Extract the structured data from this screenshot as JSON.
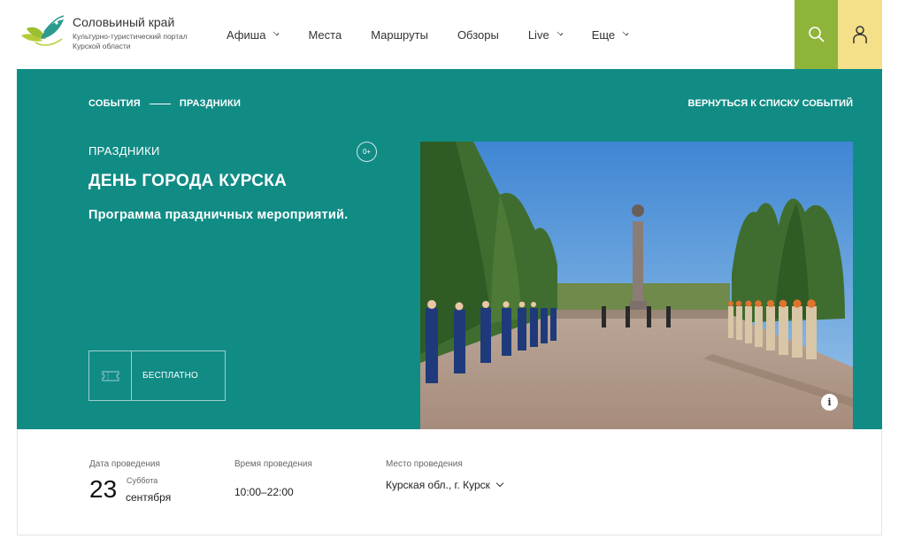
{
  "header": {
    "logo_title": "Соловьиный край",
    "logo_subtitle": "Культурно-туристический портал Курской области",
    "nav": [
      {
        "label": "Афиша",
        "has_dropdown": true
      },
      {
        "label": "Места",
        "has_dropdown": false
      },
      {
        "label": "Маршруты",
        "has_dropdown": false
      },
      {
        "label": "Обзоры",
        "has_dropdown": false
      },
      {
        "label": "Live",
        "has_dropdown": true
      },
      {
        "label": "Еще",
        "has_dropdown": true
      }
    ],
    "search_icon": "search-icon",
    "user_icon": "user-icon",
    "colors": {
      "search_bg": "#8fb43a",
      "user_bg": "#f4e089"
    }
  },
  "hero": {
    "breadcrumb": [
      "СОБЫТИЯ",
      "ПРАЗДНИКИ"
    ],
    "back_link": "ВЕРНУТЬСЯ К СПИСКУ СОБЫТИЙ",
    "category": "ПРАЗДНИКИ",
    "age_rating": "0+",
    "title": "ДЕНЬ ГОРОДА КУРСКА",
    "subtitle": "Программа праздничных мероприятий.",
    "ticket_label": "БЕСПЛАТНО",
    "ticket_icon": "ticket-icon",
    "info_icon": "i",
    "colors": {
      "background": "#118c85"
    }
  },
  "details": {
    "date_label": "Дата проведения",
    "date_day": "23",
    "date_weekday": "Суббота",
    "date_month": "сентября",
    "time_label": "Время проведения",
    "time_value": "10:00–22:00",
    "place_label": "Место проведения",
    "place_value": "Курская обл., г. Курск"
  }
}
